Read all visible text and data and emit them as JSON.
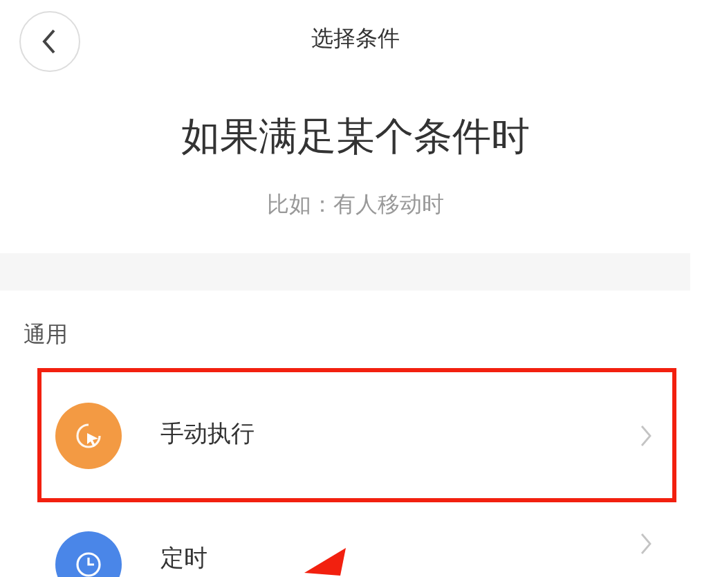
{
  "header": {
    "title": "选择条件"
  },
  "heading": "如果满足某个条件时",
  "subheading": "比如：有人移动时",
  "section": {
    "title": "通用",
    "items": [
      {
        "kind": "manual",
        "label": "手动执行",
        "color": "#f39a43",
        "highlighted": true
      },
      {
        "kind": "timer",
        "label": "定时",
        "color": "#4a86e8",
        "highlighted": false
      }
    ]
  },
  "annotation_arrow": true
}
